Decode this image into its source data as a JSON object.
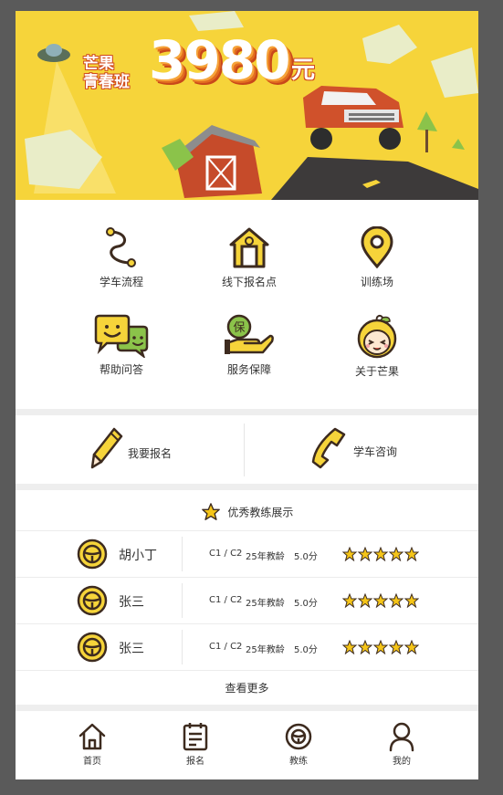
{
  "banner": {
    "title_line1": "芒果",
    "title_line2": "青春班",
    "price": "3980",
    "unit": "元"
  },
  "menu": [
    {
      "label": "学车流程",
      "icon": "route-icon"
    },
    {
      "label": "线下报名点",
      "icon": "house-icon"
    },
    {
      "label": "训练场",
      "icon": "location-pin-icon"
    },
    {
      "label": "帮助问答",
      "icon": "chat-faces-icon"
    },
    {
      "label": "服务保障",
      "icon": "insurance-hand-icon"
    },
    {
      "label": "关于芒果",
      "icon": "mango-girl-icon"
    }
  ],
  "actions": {
    "signup_label": "我要报名",
    "consult_label": "学车咨询"
  },
  "coaches_section": {
    "title": "优秀教练展示",
    "more_label": "查看更多",
    "coaches": [
      {
        "name": "胡小丁",
        "license": "C1 / C2",
        "years": "25年教龄",
        "score": "5.0分",
        "stars": 5
      },
      {
        "name": "张三",
        "license": "C1 / C2",
        "years": "25年教龄",
        "score": "5.0分",
        "stars": 5
      },
      {
        "name": "张三",
        "license": "C1 / C2",
        "years": "25年教龄",
        "score": "5.0分",
        "stars": 5
      }
    ]
  },
  "tabbar": [
    {
      "label": "首页",
      "icon": "home-icon"
    },
    {
      "label": "报名",
      "icon": "form-icon"
    },
    {
      "label": "教练",
      "icon": "steering-wheel-icon"
    },
    {
      "label": "我的",
      "icon": "user-icon"
    }
  ],
  "colors": {
    "accent": "#f6d43a",
    "icon_stroke": "#3d2b1f",
    "star": "#f5c518"
  }
}
